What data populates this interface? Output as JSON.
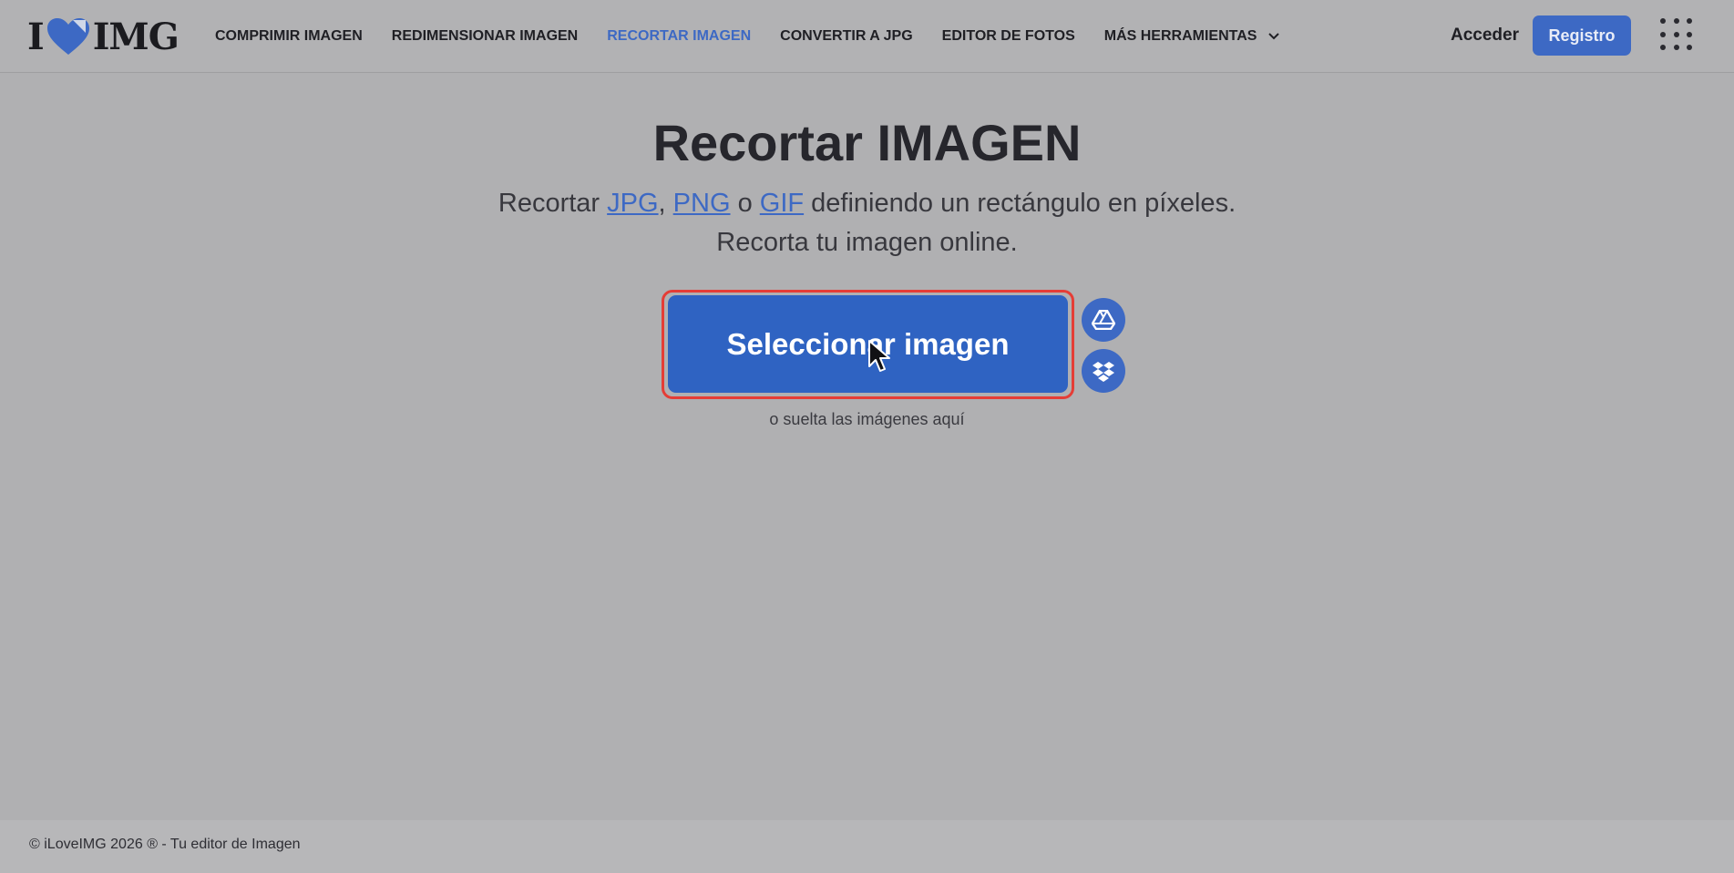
{
  "brand": {
    "logo_left": "I",
    "logo_right": "IMG",
    "accent_color": "#3d69c4",
    "heart_icon": "heart-icon"
  },
  "nav": {
    "items": [
      {
        "label": "COMPRIMIR IMAGEN",
        "active": false
      },
      {
        "label": "REDIMENSIONAR IMAGEN",
        "active": false
      },
      {
        "label": "RECORTAR IMAGEN",
        "active": true
      },
      {
        "label": "CONVERTIR A JPG",
        "active": false
      },
      {
        "label": "EDITOR DE FOTOS",
        "active": false
      },
      {
        "label": "MÁS HERRAMIENTAS",
        "active": false,
        "icon": "chevron-down-icon"
      }
    ],
    "login_label": "Acceder",
    "register_label": "Registro",
    "apps_icon": "apps-grid-icon"
  },
  "main": {
    "title": "Recortar IMAGEN",
    "subtitle": {
      "prefix": "Recortar ",
      "link1": "JPG",
      "sep1": ", ",
      "link2": "PNG",
      "sep2": " o ",
      "link3": "GIF",
      "suffix": " definiendo un rectángulo en píxeles.",
      "line2": "Recorta tu imagen online."
    },
    "select_button_label": "Seleccionar imagen",
    "cloud_buttons": [
      "google-drive-icon",
      "dropbox-icon"
    ],
    "drop_hint": "o suelta las imágenes aquí"
  },
  "footer": {
    "text": "© iLoveIMG 2026 ® - Tu editor de Imagen"
  },
  "colors": {
    "primary_button": "#2f63c2",
    "highlight_outline": "#e53d36",
    "overlay_bg": "#b0b0b2"
  }
}
